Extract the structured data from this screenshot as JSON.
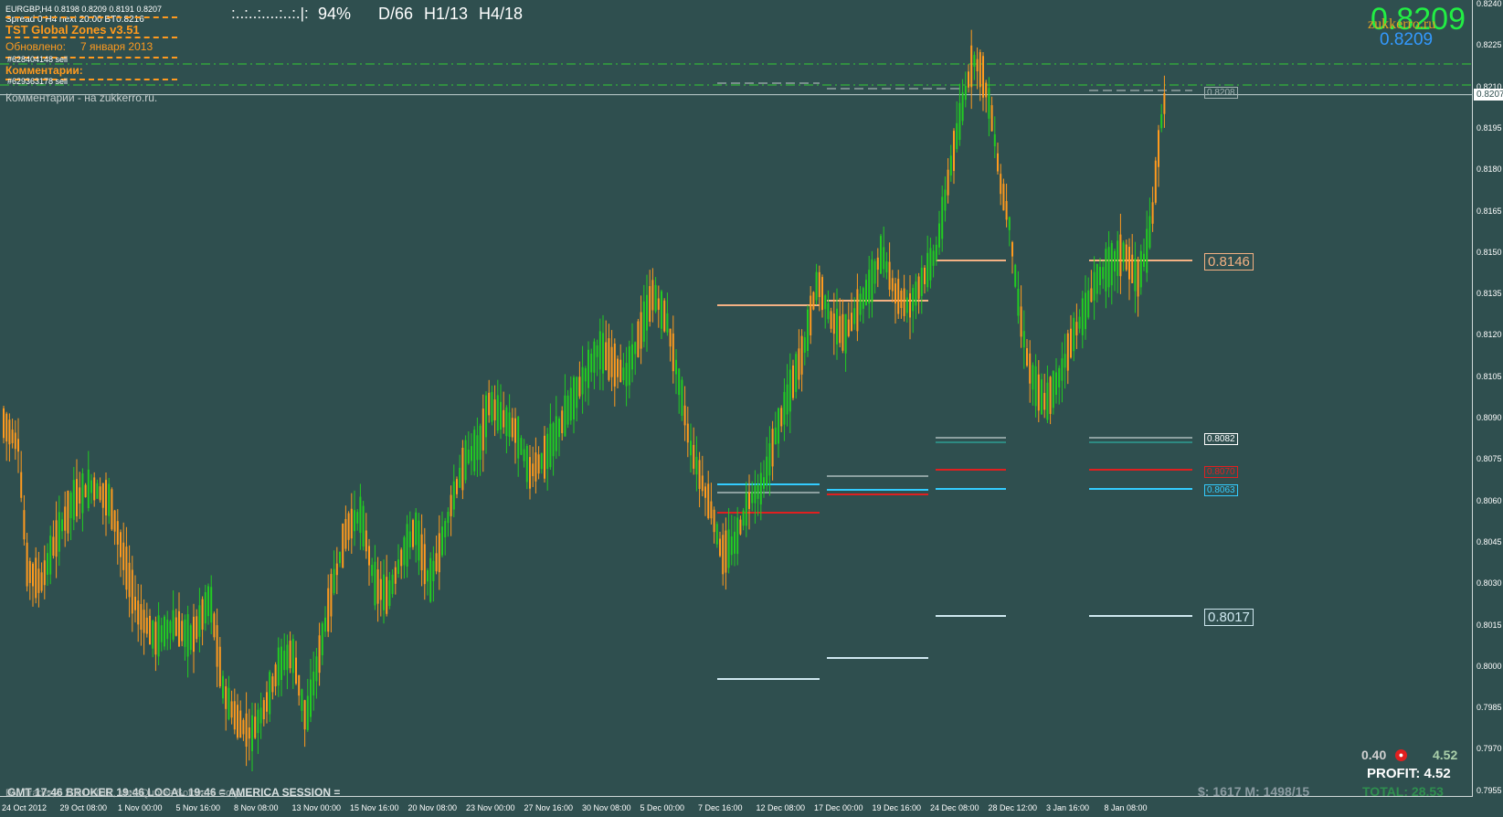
{
  "header": {
    "symbol_line": "EURGBP,H4  0.8198 0.8209 0.8191 0.8207",
    "spread_line": "Spread 0  H4 next 20:00 BT0.8216",
    "indicator_title": "TST Global Zones  v3.51",
    "updated_label": "Обновлено:",
    "updated_date": "7 января 2013",
    "order1": "#628404148 sell",
    "comments_title": "Комментарии:",
    "order2": "#629363178 sell",
    "comments_link": "Комментарии - на zukkerro.ru."
  },
  "top_status": {
    "progress_text": ":..:..:....:..:.|:",
    "percent": "94%",
    "d": "D/66",
    "h1": "H1/13",
    "h4": "H4/18"
  },
  "top_right": {
    "big_price": "0.8209",
    "brand": "zukkerro.ru",
    "sub_price": "0.8209"
  },
  "price_labels": {
    "p8208": "0.8208",
    "p8207": "0.8207",
    "p8146": "0.8146",
    "p8082": "0.8082",
    "p8070": "0.8070",
    "p8063": "0.8063",
    "p8017": "0.8017"
  },
  "y_axis": [
    "0.8240",
    "0.8225",
    "0.8210",
    "0.8195",
    "0.8180",
    "0.8165",
    "0.8150",
    "0.8135",
    "0.8120",
    "0.8105",
    "0.8090",
    "0.8075",
    "0.8060",
    "0.8045",
    "0.8030",
    "0.8015",
    "0.8000",
    "0.7985",
    "0.7970",
    "0.7955"
  ],
  "x_axis": [
    "24 Oct 2012",
    "29 Oct 08:00",
    "1 Nov 00:00",
    "5 Nov 16:00",
    "8 Nov 08:00",
    "13 Nov 00:00",
    "15 Nov 16:00",
    "20 Nov 08:00",
    "23 Nov 00:00",
    "27 Nov 16:00",
    "30 Nov 08:00",
    "5 Dec 00:00",
    "7 Dec 16:00",
    "12 Dec 08:00",
    "17 Dec 00:00",
    "19 Dec 16:00",
    "24 Dec 08:00",
    "28 Dec 12:00",
    "3 Jan 16:00",
    "8 Jan 08:00"
  ],
  "bottom": {
    "time_line": "GMT 17:46  BROKER 19:46  LOCAL 19:46  = AMERICA SESSION =",
    "copyright": "BM Trader,© 2001-2012, MetaQuotes Software Corp.",
    "val1": "0.40",
    "val2": "4.52",
    "profit": "PROFIT: 4.52",
    "balance": "$: 1617   M: 1498/15",
    "total": "TOTAL: 28.53"
  },
  "colors": {
    "background": "#2f4f4f",
    "bull": "#22cc22",
    "bear": "#ff9a1e",
    "zone_orange": "#f4b183",
    "zone_red": "#e02020",
    "zone_cyan": "#33ccff",
    "zone_white": "#e8f0f0"
  }
}
